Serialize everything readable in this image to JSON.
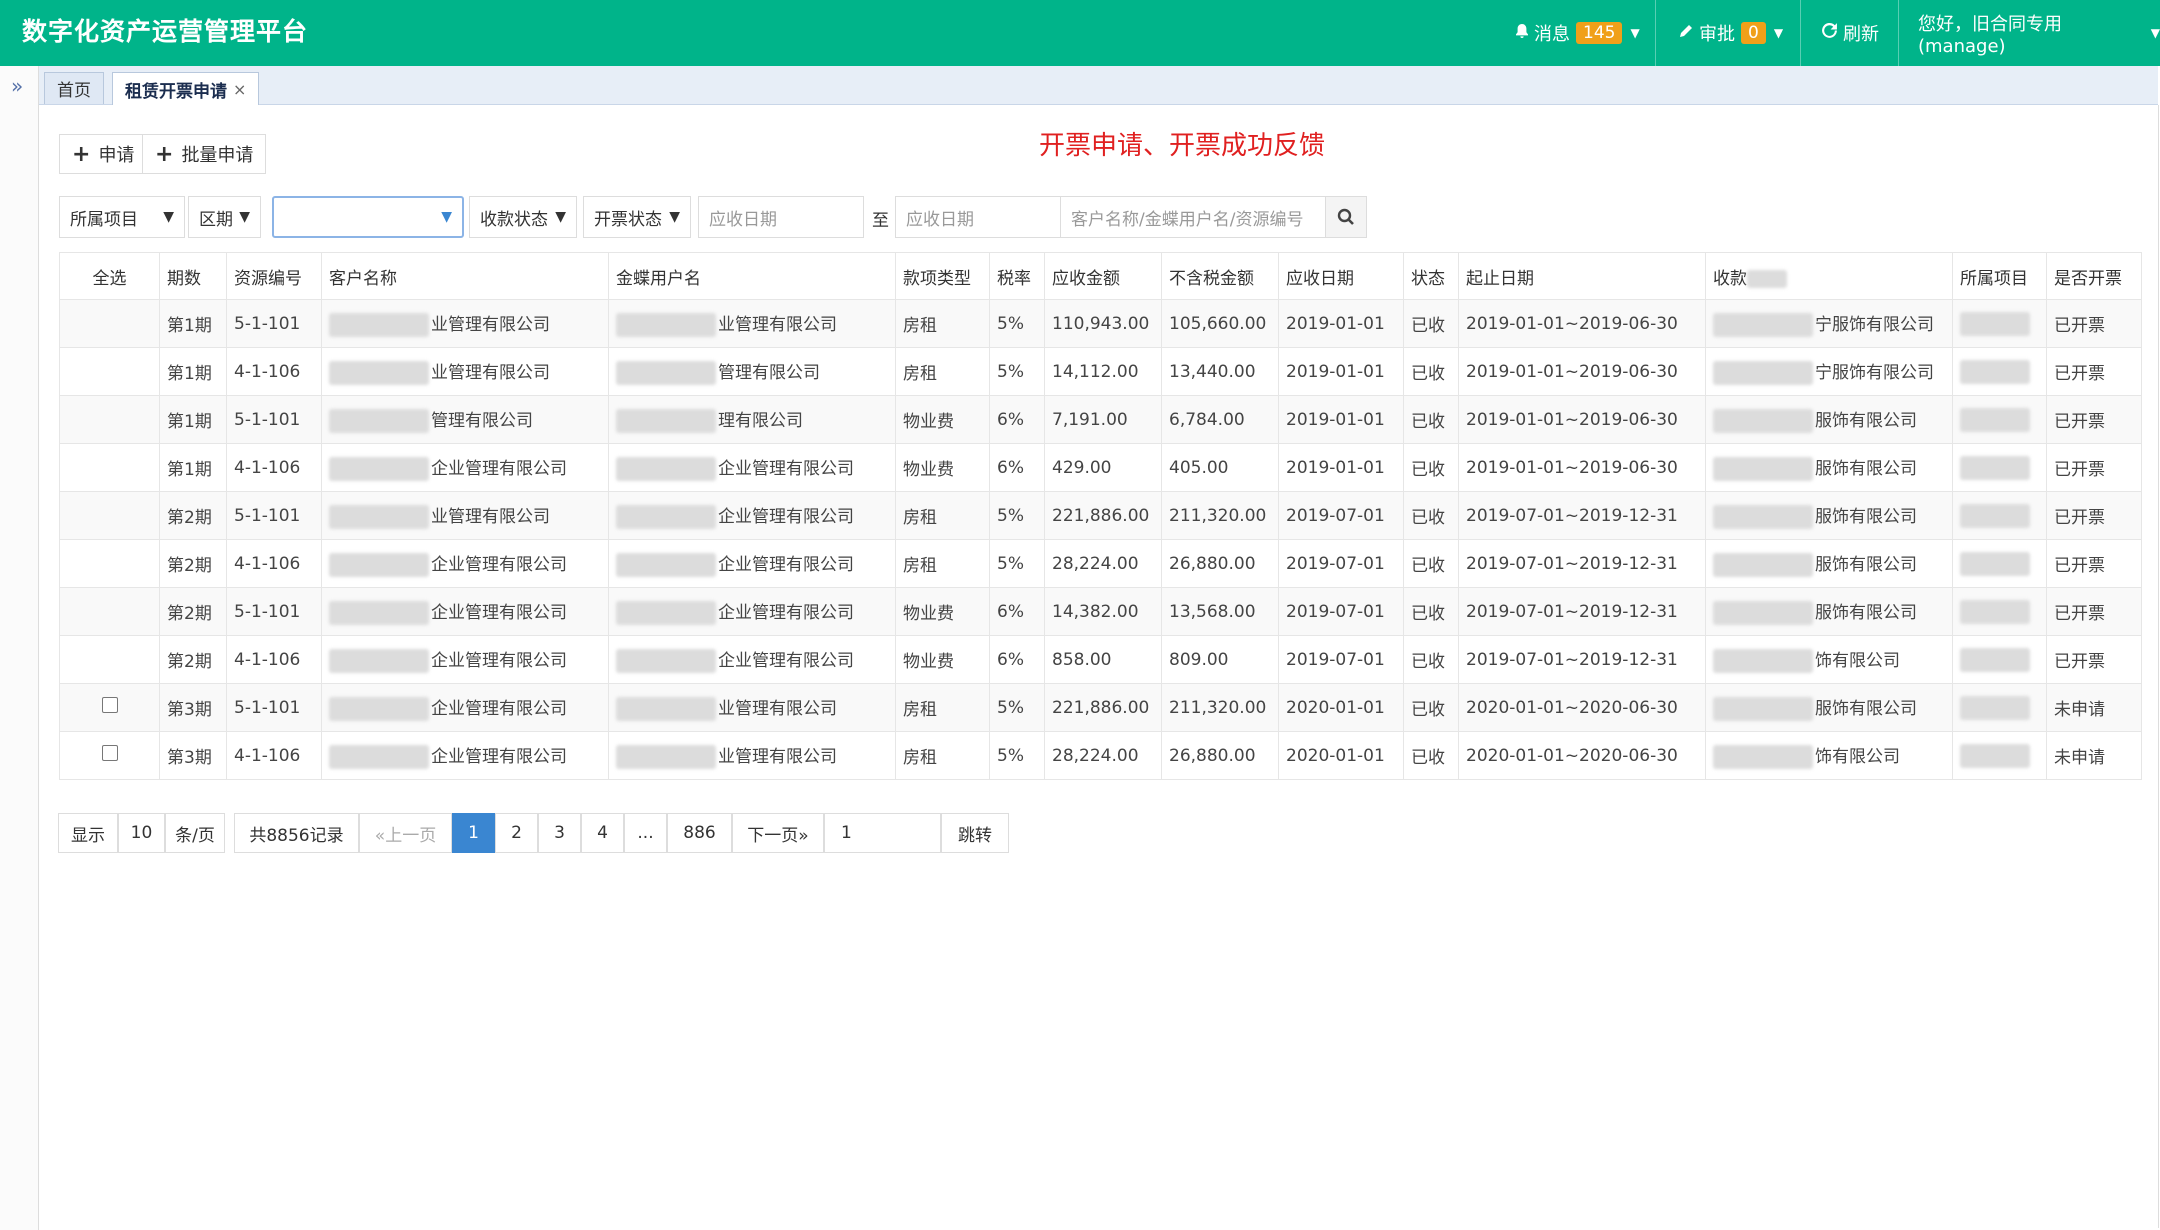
{
  "header": {
    "title": "数字化资产运营管理平台",
    "messages_label": "消息",
    "messages_count": "145",
    "approval_label": "审批",
    "approval_count": "0",
    "refresh_label": "刷新",
    "user_label": "您好，旧合同专用(manage)"
  },
  "tabs": {
    "home": "首页",
    "current": "租赁开票申请",
    "close": "×"
  },
  "toolbar": {
    "apply": "申请",
    "batch_apply": "批量申请",
    "notice": "开票申请、开票成功反馈"
  },
  "filters": {
    "project": "所属项目",
    "period": "区期",
    "collection_status": "收款状态",
    "invoice_status": "开票状态",
    "date_from_placeholder": "应收日期",
    "to": "至",
    "date_to_placeholder": "应收日期",
    "keyword_placeholder": "客户名称/金蝶用户名/资源编号"
  },
  "table": {
    "headers": [
      "全选",
      "期数",
      "资源编号",
      "客户名称",
      "金蝶用户名",
      "款项类型",
      "税率",
      "应收金额",
      "不含税金额",
      "应收日期",
      "状态",
      "起止日期",
      "收款",
      "所属项目",
      "是否开票"
    ],
    "rows": [
      {
        "period": "第1期",
        "res": "5-1-101",
        "cust": "业管理有限公司",
        "kd": "业管理有限公司",
        "type": "房租",
        "rate": "5%",
        "amt": "110,943.00",
        "net": "105,660.00",
        "due": "2019-01-01",
        "st": "已收",
        "range": "2019-01-01~2019-06-30",
        "payee": "宁服饰有限公司",
        "inv": "已开票"
      },
      {
        "period": "第1期",
        "res": "4-1-106",
        "cust": "业管理有限公司",
        "kd": "管理有限公司",
        "type": "房租",
        "rate": "5%",
        "amt": "14,112.00",
        "net": "13,440.00",
        "due": "2019-01-01",
        "st": "已收",
        "range": "2019-01-01~2019-06-30",
        "payee": "宁服饰有限公司",
        "inv": "已开票"
      },
      {
        "period": "第1期",
        "res": "5-1-101",
        "cust": "管理有限公司",
        "kd": "理有限公司",
        "type": "物业费",
        "rate": "6%",
        "amt": "7,191.00",
        "net": "6,784.00",
        "due": "2019-01-01",
        "st": "已收",
        "range": "2019-01-01~2019-06-30",
        "payee": "服饰有限公司",
        "inv": "已开票"
      },
      {
        "period": "第1期",
        "res": "4-1-106",
        "cust": "企业管理有限公司",
        "kd": "企业管理有限公司",
        "type": "物业费",
        "rate": "6%",
        "amt": "429.00",
        "net": "405.00",
        "due": "2019-01-01",
        "st": "已收",
        "range": "2019-01-01~2019-06-30",
        "payee": "服饰有限公司",
        "inv": "已开票"
      },
      {
        "period": "第2期",
        "res": "5-1-101",
        "cust": "业管理有限公司",
        "kd": "企业管理有限公司",
        "type": "房租",
        "rate": "5%",
        "amt": "221,886.00",
        "net": "211,320.00",
        "due": "2019-07-01",
        "st": "已收",
        "range": "2019-07-01~2019-12-31",
        "payee": "服饰有限公司",
        "inv": "已开票"
      },
      {
        "period": "第2期",
        "res": "4-1-106",
        "cust": "企业管理有限公司",
        "kd": "企业管理有限公司",
        "type": "房租",
        "rate": "5%",
        "amt": "28,224.00",
        "net": "26,880.00",
        "due": "2019-07-01",
        "st": "已收",
        "range": "2019-07-01~2019-12-31",
        "payee": "服饰有限公司",
        "inv": "已开票"
      },
      {
        "period": "第2期",
        "res": "5-1-101",
        "cust": "企业管理有限公司",
        "kd": "企业管理有限公司",
        "type": "物业费",
        "rate": "6%",
        "amt": "14,382.00",
        "net": "13,568.00",
        "due": "2019-07-01",
        "st": "已收",
        "range": "2019-07-01~2019-12-31",
        "payee": "服饰有限公司",
        "inv": "已开票"
      },
      {
        "period": "第2期",
        "res": "4-1-106",
        "cust": "企业管理有限公司",
        "kd": "企业管理有限公司",
        "type": "物业费",
        "rate": "6%",
        "amt": "858.00",
        "net": "809.00",
        "due": "2019-07-01",
        "st": "已收",
        "range": "2019-07-01~2019-12-31",
        "payee": "饰有限公司",
        "inv": "已开票"
      },
      {
        "period": "第3期",
        "res": "5-1-101",
        "cust": "企业管理有限公司",
        "kd": "业管理有限公司",
        "type": "房租",
        "rate": "5%",
        "amt": "221,886.00",
        "net": "211,320.00",
        "due": "2020-01-01",
        "st": "已收",
        "range": "2020-01-01~2020-06-30",
        "payee": "服饰有限公司",
        "inv": "未申请"
      },
      {
        "period": "第3期",
        "res": "4-1-106",
        "cust": "企业管理有限公司",
        "kd": "业管理有限公司",
        "type": "房租",
        "rate": "5%",
        "amt": "28,224.00",
        "net": "26,880.00",
        "due": "2020-01-01",
        "st": "已收",
        "range": "2020-01-01~2020-06-30",
        "payee": "饰有限公司",
        "inv": "未申请"
      }
    ]
  },
  "pagination": {
    "show": "显示",
    "page_size": "10",
    "per_page": "条/页",
    "total": "共8856记录",
    "prev": "«上一页",
    "pages": [
      "1",
      "2",
      "3",
      "4",
      "...",
      "886"
    ],
    "next": "下一页»",
    "jump_value": "1",
    "jump": "跳转"
  },
  "colors": {
    "header_bg": "#00b48a",
    "badge": "#f0a019",
    "invoiced": "#e01818",
    "not_applied": "#179b17",
    "active_page": "#3a86d1"
  }
}
